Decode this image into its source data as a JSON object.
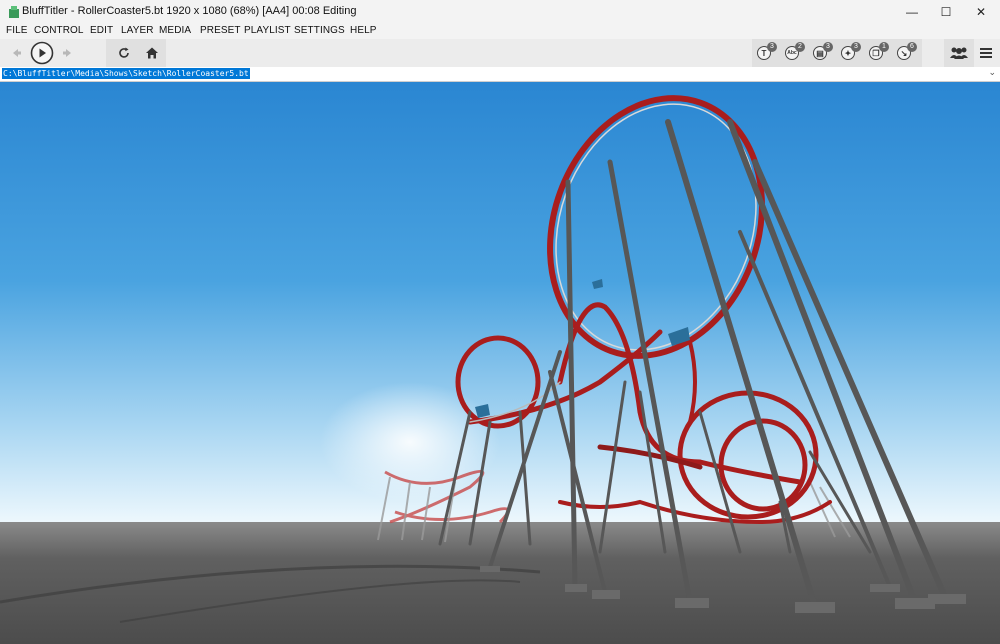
{
  "window": {
    "title": "BluffTitler - RollerCoaster5.bt 1920 x 1080 (68%) [AA4] 00:08 Editing",
    "controls": [
      "—",
      "☐",
      "✕"
    ]
  },
  "menu": [
    "FILE",
    "CONTROL",
    "EDIT",
    "LAYER",
    "MEDIA",
    "PRESET",
    "PLAYLIST",
    "SETTINGS",
    "HELP"
  ],
  "toolbar": {
    "icons": [
      "prev-icon",
      "play-icon",
      "next-icon",
      "refresh-icon",
      "home-icon"
    ],
    "layers": [
      {
        "glyph": "T",
        "count": "3",
        "icon": "text-layer-icon"
      },
      {
        "glyph": "Abc",
        "count": "2",
        "icon": "font-layer-icon"
      },
      {
        "glyph": "▤",
        "count": "3",
        "icon": "picture-layer-icon"
      },
      {
        "glyph": "✦",
        "count": "3",
        "icon": "particle-layer-icon"
      },
      {
        "glyph": "❒",
        "count": "1",
        "icon": "model-layer-icon"
      },
      {
        "glyph": "↘",
        "count": "6",
        "icon": "light-layer-icon"
      }
    ],
    "right_icons": [
      "users-icon",
      "hamburger-menu-icon"
    ]
  },
  "path": {
    "value": "C:\\BluffTitler\\Media\\Shows\\Sketch\\RollerCoaster5.bt",
    "dropdown": "⌄"
  },
  "colors": {
    "sky_top": "#2e8fd6",
    "sky_bottom": "#dff1fb",
    "ground": "#5a5a5a",
    "track_red": "#b42020",
    "pillar": "#555555",
    "selection": "#0078d7"
  }
}
